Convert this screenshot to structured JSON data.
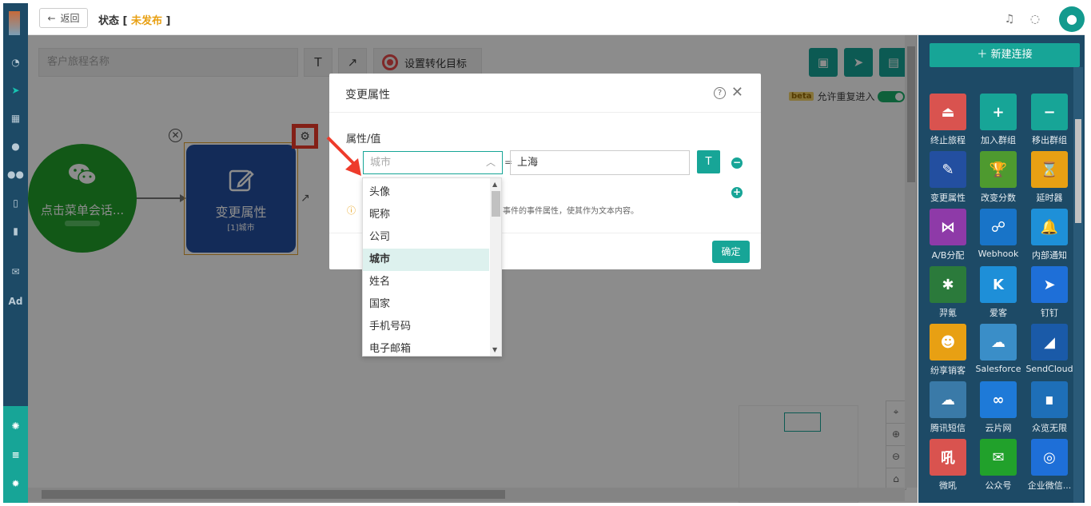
{
  "topbar": {
    "back_label": "返回",
    "status_prefix": "状态 [ ",
    "status_value": "未发布",
    "status_suffix": " ]"
  },
  "leftnav": {
    "items": [
      "dashboard-icon",
      "send-icon",
      "layout-icon",
      "user-icon",
      "users-icon",
      "bookmark-icon",
      "chart-icon",
      "wechat-icon",
      "Ad"
    ]
  },
  "toolbar": {
    "journey_placeholder": "客户旅程名称",
    "text_icon": "T",
    "arrow_icon": "↗",
    "goal_label": "设置转化目标"
  },
  "canvas": {
    "beta_badge": "beta",
    "repeat_label": "允许重复进入",
    "wechat_node_label": "点击菜单会话...",
    "change_node_label": "变更属性",
    "change_node_sub": "[1]城市"
  },
  "right_panel": {
    "new_connection": "新建连接",
    "tiles": [
      {
        "label": "终止旅程",
        "color": "#d9534f",
        "icon": "⏏"
      },
      {
        "label": "加入群组",
        "color": "#17a597",
        "icon": "+"
      },
      {
        "label": "移出群组",
        "color": "#17a597",
        "icon": "−"
      },
      {
        "label": "变更属性",
        "color": "#234fa0",
        "icon": "✎"
      },
      {
        "label": "改变分数",
        "color": "#4e9a2f",
        "icon": "🏆"
      },
      {
        "label": "延时器",
        "color": "#e8a013",
        "icon": "⌛"
      },
      {
        "label": "A/B分配",
        "color": "#8e3aa8",
        "icon": "⋈"
      },
      {
        "label": "Webhook",
        "color": "#1874c8",
        "icon": "☍"
      },
      {
        "label": "内部通知",
        "color": "#1e90d8",
        "icon": "🔔"
      },
      {
        "label": "羿氪",
        "color": "#2b7a3b",
        "icon": "✱"
      },
      {
        "label": "爱客",
        "color": "#1e8fd8",
        "icon": "K"
      },
      {
        "label": "钉钉",
        "color": "#1e6fd8",
        "icon": "➤"
      },
      {
        "label": "纷享销客",
        "color": "#e8a013",
        "icon": "☻"
      },
      {
        "label": "Salesforce",
        "color": "#3a8ec8",
        "icon": "☁"
      },
      {
        "label": "SendCloud",
        "color": "#1a5aa8",
        "icon": "◢"
      },
      {
        "label": "腾讯短信",
        "color": "#3a7aa8",
        "icon": "☁"
      },
      {
        "label": "云片网",
        "color": "#1e7ad8",
        "icon": "∞"
      },
      {
        "label": "众览无限",
        "color": "#1e6fb8",
        "icon": "∎"
      },
      {
        "label": "微吼",
        "color": "#d9534f",
        "icon": "吼"
      },
      {
        "label": "公众号",
        "color": "#21a12b",
        "icon": "✉"
      },
      {
        "label": "企业微信...",
        "color": "#1e6fd8",
        "icon": "◎"
      }
    ]
  },
  "dialog": {
    "title": "变更属性",
    "field_label": "属性/值",
    "select_placeholder": "城市",
    "eq_sign": "=",
    "value": "上海",
    "hint_text": "事件的事件属性，使其作为文本内容。",
    "ok_label": "确定"
  },
  "dropdown": {
    "options": [
      "头像",
      "昵称",
      "公司",
      "城市",
      "姓名",
      "国家",
      "手机号码",
      "电子邮箱"
    ],
    "selected": "城市"
  }
}
